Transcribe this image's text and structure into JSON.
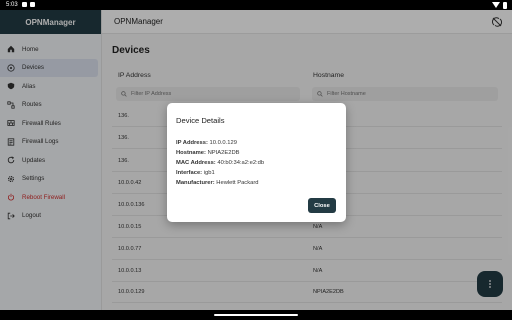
{
  "status_bar": {
    "time": "5:03"
  },
  "sidebar": {
    "title": "OPNManager",
    "items": [
      {
        "label": "Home",
        "icon": "home-icon"
      },
      {
        "label": "Devices",
        "icon": "devices-icon"
      },
      {
        "label": "Alias",
        "icon": "alias-icon"
      },
      {
        "label": "Routes",
        "icon": "routes-icon"
      },
      {
        "label": "Firewall Rules",
        "icon": "firewall-rules-icon"
      },
      {
        "label": "Firewall Logs",
        "icon": "firewall-logs-icon"
      },
      {
        "label": "Updates",
        "icon": "updates-icon"
      },
      {
        "label": "Settings",
        "icon": "gear-icon"
      },
      {
        "label": "Reboot Firewall",
        "icon": "power-icon"
      },
      {
        "label": "Logout",
        "icon": "logout-icon"
      }
    ]
  },
  "topbar": {
    "title": "OPNManager",
    "action_icon": "sync-off-icon"
  },
  "page": {
    "title": "Devices",
    "columns": {
      "ip": "IP Address",
      "hostname": "Hostname"
    },
    "filters": {
      "ip_placeholder": "Filter IP Address",
      "hostname_placeholder": "Filter Hostname"
    },
    "rows": [
      {
        "ip": "136.",
        "hostname": ""
      },
      {
        "ip": "136.",
        "hostname": ""
      },
      {
        "ip": "136.",
        "hostname": ""
      },
      {
        "ip": "10.0.0.42",
        "hostname": ""
      },
      {
        "ip": "10.0.0.136",
        "hostname": ""
      },
      {
        "ip": "10.0.0.15",
        "hostname": "N/A"
      },
      {
        "ip": "10.0.0.77",
        "hostname": "N/A"
      },
      {
        "ip": "10.0.0.13",
        "hostname": "N/A"
      },
      {
        "ip": "10.0.0.129",
        "hostname": "NPIA2E2DB"
      }
    ]
  },
  "dialog": {
    "title": "Device Details",
    "details": [
      {
        "label": "IP Address:",
        "value": "10.0.0.129"
      },
      {
        "label": "Hostname:",
        "value": "NPIA2E2DB"
      },
      {
        "label": "MAC Address:",
        "value": "40:b0:34:a2:e2:db"
      },
      {
        "label": "Interface:",
        "value": "igb1"
      },
      {
        "label": "Manufacturer:",
        "value": "Hewlett Packard"
      }
    ],
    "close_label": "Close"
  },
  "fab": {
    "icon": "more-vert-icon"
  },
  "colors": {
    "primary": "#233b44",
    "danger": "#d32f2f",
    "active_nav": "#dde4f1"
  }
}
